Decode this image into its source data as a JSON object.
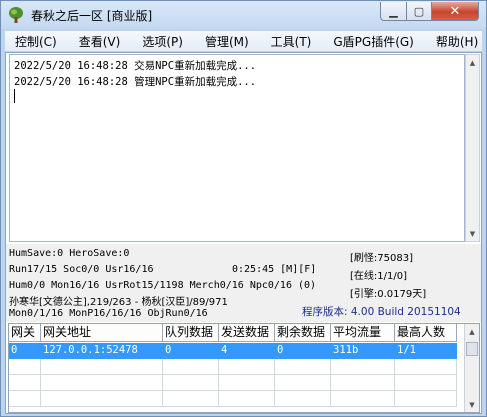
{
  "window": {
    "title": "春秋之后一区 [商业版]",
    "min_glyph": "▁",
    "max_glyph": "▢",
    "close_glyph": "✕"
  },
  "menu": [
    "控制(C)",
    "查看(V)",
    "选项(P)",
    "管理(M)",
    "工具(T)",
    "G盾PG插件(G)",
    "帮助(H)"
  ],
  "log": {
    "lines": [
      "2022/5/20 16:48:28 交易NPC重新加载完成...",
      "2022/5/20 16:48:28 管理NPC重新加载完成..."
    ]
  },
  "status": {
    "line1": "HumSave:0 HeroSave:0",
    "line2": "Run17/15 Soc0/0 Usr16/16",
    "time": "0:25:45 [M][F]",
    "line3": "Hum0/0 Mon16/16 UsrRot15/1198 Merch0/16 Npc0/16 (0)",
    "line4": "孙寒华[文德公主],219/263 - 杨秋[汉臣]/89/971",
    "line5": "Mon0/1/16 MonP16/16/16 ObjRun0/16",
    "refresh": "[刷怪:75083]",
    "online": "[在线:1/1/0]",
    "engine": "[引擎:0.0179天]",
    "version": "程序版本: 4.00 Build 20151104"
  },
  "table": {
    "columns": [
      "网关",
      "网关地址",
      "队列数据",
      "发送数据",
      "剩余数据",
      "平均流量",
      "最高人数"
    ],
    "rows": [
      [
        "0",
        "127.0.0.1:52478",
        "0",
        "4",
        "0",
        "311b",
        "1/1"
      ]
    ]
  },
  "colors": {
    "selection": "#3399ff",
    "version_text": "#1b2f8c",
    "close_button": "#c7452d"
  },
  "icons": [
    "app-tree-icon",
    "minimize-icon",
    "maximize-icon",
    "close-icon",
    "scroll-up-icon",
    "scroll-down-icon"
  ]
}
